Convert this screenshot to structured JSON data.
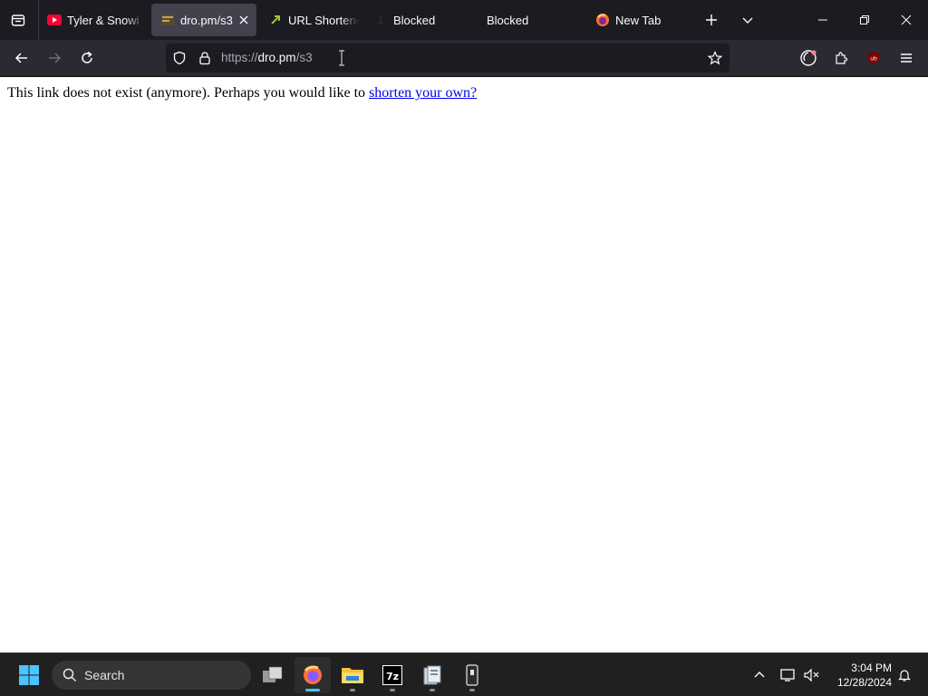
{
  "browser": {
    "tabs": [
      {
        "title": "Tyler & Snowi",
        "favicon": "youtube-icon"
      },
      {
        "title": "dro.pm/s3",
        "favicon": "site-icon",
        "active": true
      },
      {
        "title": "URL Shortener",
        "favicon": "shortener-icon"
      },
      {
        "title": "Blocked",
        "favicon": "blocked-icon"
      },
      {
        "title": "Blocked",
        "favicon": "none"
      },
      {
        "title": "New Tab",
        "favicon": "firefox-icon"
      }
    ],
    "url": {
      "scheme": "https://",
      "host": "dro.pm",
      "path": "/s3"
    },
    "toolbar_icons": [
      "back-icon",
      "forward-icon",
      "reload-icon",
      "tracking-shield-icon",
      "lock-icon",
      "bookmark-star-icon",
      "firefox-account-icon",
      "extensions-icon",
      "ublock-icon",
      "menu-icon"
    ]
  },
  "page": {
    "message": "This link does not exist (anymore). Perhaps you would like to ",
    "link_text": "shorten your own?"
  },
  "taskbar": {
    "search_label": "Search",
    "apps": [
      "windows-start-icon",
      "task-view-icon",
      "firefox-icon",
      "file-explorer-icon",
      "7zip-icon",
      "app-icon",
      "phone-link-icon"
    ],
    "time": "3:04 PM",
    "date": "12/28/2024"
  },
  "colors": {
    "tabstrip_bg": "#1c1b22",
    "toolbar_bg": "#2b2a33",
    "urlbar_bg": "#1c1b22",
    "active_tab_bg": "#42414d",
    "link": "#0000ee",
    "taskbar_bg": "#202020",
    "accent": "#4cc2ff"
  }
}
